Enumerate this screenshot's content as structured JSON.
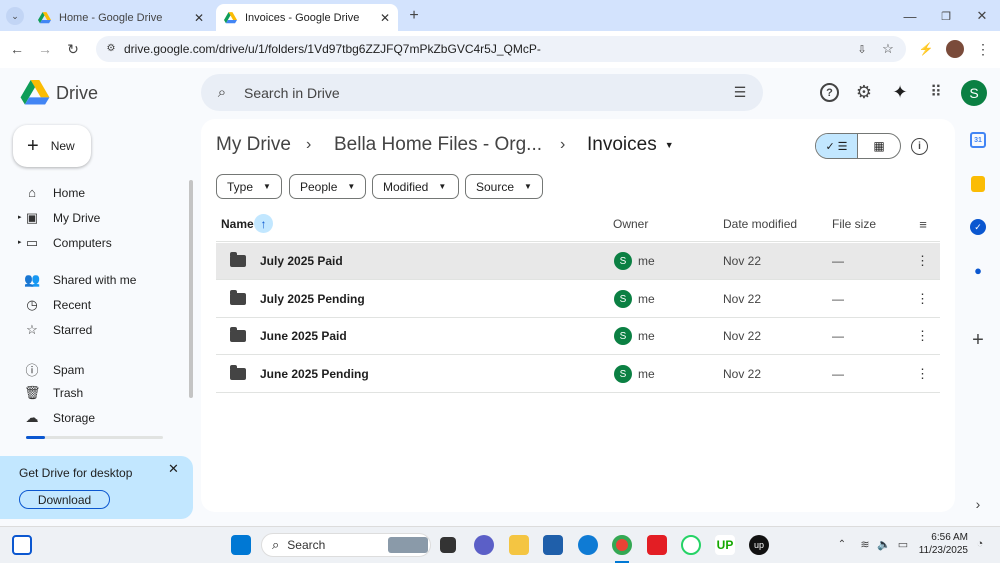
{
  "browser": {
    "tabs": [
      {
        "title": "Home - Google Drive"
      },
      {
        "title": "Invoices - Google Drive"
      }
    ],
    "url": "drive.google.com/drive/u/1/folders/1Vd97tbg6ZZJFQ7mPkZbGVC4r5J_QMcP-"
  },
  "app": {
    "name": "Drive",
    "search_placeholder": "Search in Drive",
    "avatar_letter": "S"
  },
  "sidebar": {
    "new_label": "New",
    "items": [
      {
        "label": "Home",
        "icon": "home-icon"
      },
      {
        "label": "My Drive",
        "icon": "drive-icon"
      },
      {
        "label": "Computers",
        "icon": "computer-icon"
      },
      {
        "label": "Shared with me",
        "icon": "people-icon"
      },
      {
        "label": "Recent",
        "icon": "clock-icon"
      },
      {
        "label": "Starred",
        "icon": "star-icon"
      },
      {
        "label": "Spam",
        "icon": "spam-icon"
      },
      {
        "label": "Trash",
        "icon": "trash-icon"
      },
      {
        "label": "Storage",
        "icon": "cloud-icon"
      }
    ],
    "storage_used_fraction": 0.14,
    "promo": {
      "title": "Get Drive for desktop",
      "button": "Download"
    }
  },
  "breadcrumb": [
    "My Drive",
    "Bella Home Files - Org...",
    "Invoices"
  ],
  "filters": [
    "Type",
    "People",
    "Modified",
    "Source"
  ],
  "table": {
    "headers": {
      "name": "Name",
      "owner": "Owner",
      "date": "Date modified",
      "size": "File size"
    },
    "rows": [
      {
        "name": "July 2025 Paid",
        "owner": "me",
        "owner_initial": "S",
        "date": "Nov 22",
        "size": "—"
      },
      {
        "name": "July 2025 Pending",
        "owner": "me",
        "owner_initial": "S",
        "date": "Nov 22",
        "size": "—"
      },
      {
        "name": "June 2025 Paid",
        "owner": "me",
        "owner_initial": "S",
        "date": "Nov 22",
        "size": "—"
      },
      {
        "name": "June 2025 Pending",
        "owner": "me",
        "owner_initial": "S",
        "date": "Nov 22",
        "size": "—"
      }
    ]
  },
  "taskbar": {
    "search_label": "Search",
    "time": "6:56 AM",
    "date": "11/23/2025"
  },
  "colors": {
    "accent": "#0b57d0",
    "avatar": "#0b8043",
    "selected_row": "#e8e8e8"
  }
}
